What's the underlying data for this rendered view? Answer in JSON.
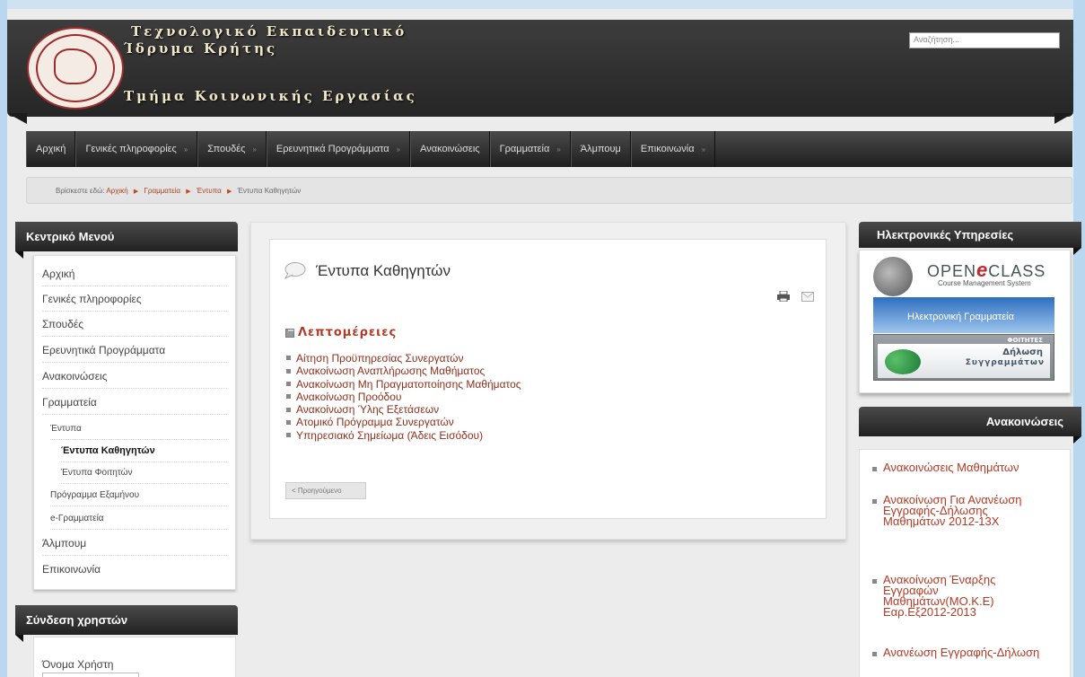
{
  "header": {
    "title_line1": "Τεχνολογικό Εκπαιδευτικό",
    "title_line2": "Ίδρυμα Κρήτης",
    "title_line3": "Τμήμα Κοινωνικής Εργασίας",
    "search_placeholder": "Αναζήτηση..."
  },
  "nav": {
    "items": [
      {
        "label": "Αρχική",
        "has_arrow": false
      },
      {
        "label": "Γενικές πληροφορίες",
        "has_arrow": true
      },
      {
        "label": "Σπουδές",
        "has_arrow": true
      },
      {
        "label": "Ερευνητικά Προγράμματα",
        "has_arrow": true
      },
      {
        "label": "Ανακοινώσεις",
        "has_arrow": false
      },
      {
        "label": "Γραμματεία",
        "has_arrow": true
      },
      {
        "label": "Άλμπουμ",
        "has_arrow": false
      },
      {
        "label": "Επικοινωνία",
        "has_arrow": true
      }
    ]
  },
  "breadcrumb": {
    "prefix": "Βρίσκεστε εδώ:",
    "items": [
      "Αρχική",
      "Γραμματεία",
      "Έντυπα",
      "Έντυπα Καθηγητών"
    ]
  },
  "sidebar": {
    "menu_title": "Κεντρικό Μενού",
    "items": [
      {
        "label": "Αρχική"
      },
      {
        "label": "Γενικές πληροφορίες"
      },
      {
        "label": "Σπουδές"
      },
      {
        "label": "Ερευνητικά Προγράμματα"
      },
      {
        "label": "Ανακοινώσεις"
      },
      {
        "label": "Γραμματεία"
      },
      {
        "label": "Έντυπα"
      },
      {
        "label": "Έντυπα Καθηγητών"
      },
      {
        "label": "Έντυπα Φοιτητών"
      },
      {
        "label": "Πρόγραμμα Εξαμήνου"
      },
      {
        "label": "e-Γραμματεία"
      },
      {
        "label": "Άλμπουμ"
      },
      {
        "label": "Επικοινωνία"
      }
    ],
    "login_title": "Σύνδεση χρηστών",
    "username_label": "Όνομα Χρήστη"
  },
  "main": {
    "title": "Έντυπα Καθηγητών",
    "section_title": "Λεπτομέρειες",
    "links": [
      "Αίτηση Προϋπηρεσίας Συνεργατών",
      "Ανακοίνωση Αναπλήρωσης Μαθήματος",
      "Ανακοίνωση Μη Πραγματοποίησης Μαθήματος",
      "Ανακοίνωση Προόδου",
      "Ανακοίνωση Ύλης Εξετάσεων",
      "Ατομικό Πρόγραμμα Συνεργατών",
      "Υπηρεσιακό Σημείωμα (Άδεις Εισόδου)"
    ],
    "prev_label": "< Προηγούμενο"
  },
  "right": {
    "services_title": "Ηλεκτρονικές Υπηρεσίες",
    "openclass_open": "OPEN",
    "openclass_e": "e",
    "openclass_class": "CLASS",
    "openclass_sub": "Course Management System",
    "grammateia_label": "Ηλεκτρονική Γραμματεία",
    "dilosi_bar": "ΦΟΙΤΗΤΕΣ",
    "dilosi_line1": "Δήλωση",
    "dilosi_line2": "Συγγραμμάτων",
    "announcements_title": "Ανακοινώσεις",
    "announcements": [
      "Ανακοινώσεις Μαθημάτων",
      "Ανακοίνωση Για Ανανέωση Εγγραφής-Δήλωσης Μαθημάτων 2012-13Χ",
      "Ανακοίνωση Έναρξης Εγγραφών Μαθημάτων(ΜΟ.Κ.Ε) Εαρ.Εξ2012-2013",
      "Ανανέωση Εγγραφής-Δήλωση"
    ]
  },
  "colors": {
    "link": "#8e2f1a",
    "accent": "#b33a24",
    "header_bg": "#262626",
    "page_bg": "#b9d8ef"
  }
}
